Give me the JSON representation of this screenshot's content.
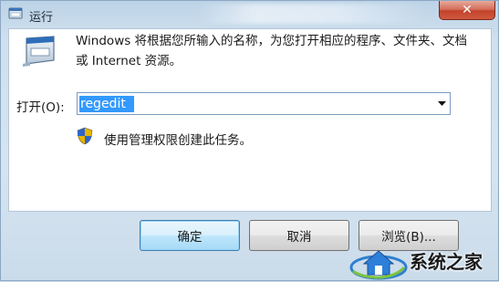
{
  "window": {
    "title": "运行",
    "close_symbol": "✕"
  },
  "dialog": {
    "description": "Windows 将根据您所输入的名称，为您打开相应的程序、文件夹、文档或 Internet 资源。",
    "open_label": "打开(O):",
    "open_value": "regedit",
    "admin_note": "使用管理权限创建此任务。"
  },
  "buttons": {
    "ok": "确定",
    "cancel": "取消",
    "browse": "浏览(B)..."
  },
  "watermark": {
    "text": "系统之家"
  },
  "icons": {
    "app": "run-app-icon",
    "run": "run-dialog-icon",
    "shield": "uac-shield-icon",
    "dropdown": "chevron-down-icon",
    "close": "close-icon"
  },
  "colors": {
    "selection": "#3399ff",
    "close_button": "#c3422b",
    "default_button_border": "#3c7fb1"
  }
}
